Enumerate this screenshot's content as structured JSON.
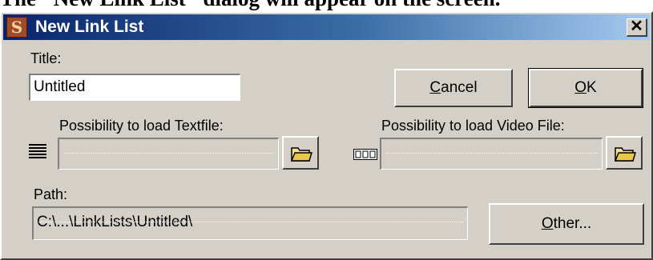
{
  "caption": "The \"New Link List\" dialog will appear on the screen.",
  "dialog": {
    "title": "New Link List",
    "close": "✕",
    "app_icon_glyph": "S"
  },
  "form": {
    "title_label": "Title:",
    "title_value": "Untitled",
    "textfile_label": "Possibility to load Textfile:",
    "textfile_value": "",
    "videofile_label": "Possibility to load Video File:",
    "videofile_value": "",
    "path_label": "Path:",
    "path_value": "C:\\...\\LinkLists\\Untitled\\"
  },
  "buttons": {
    "cancel": "Cancel",
    "ok": "OK",
    "other": "Other..."
  },
  "icons": {
    "text_lines": "text-lines-icon",
    "film": "film-icon",
    "folder": "folder-open-icon"
  }
}
